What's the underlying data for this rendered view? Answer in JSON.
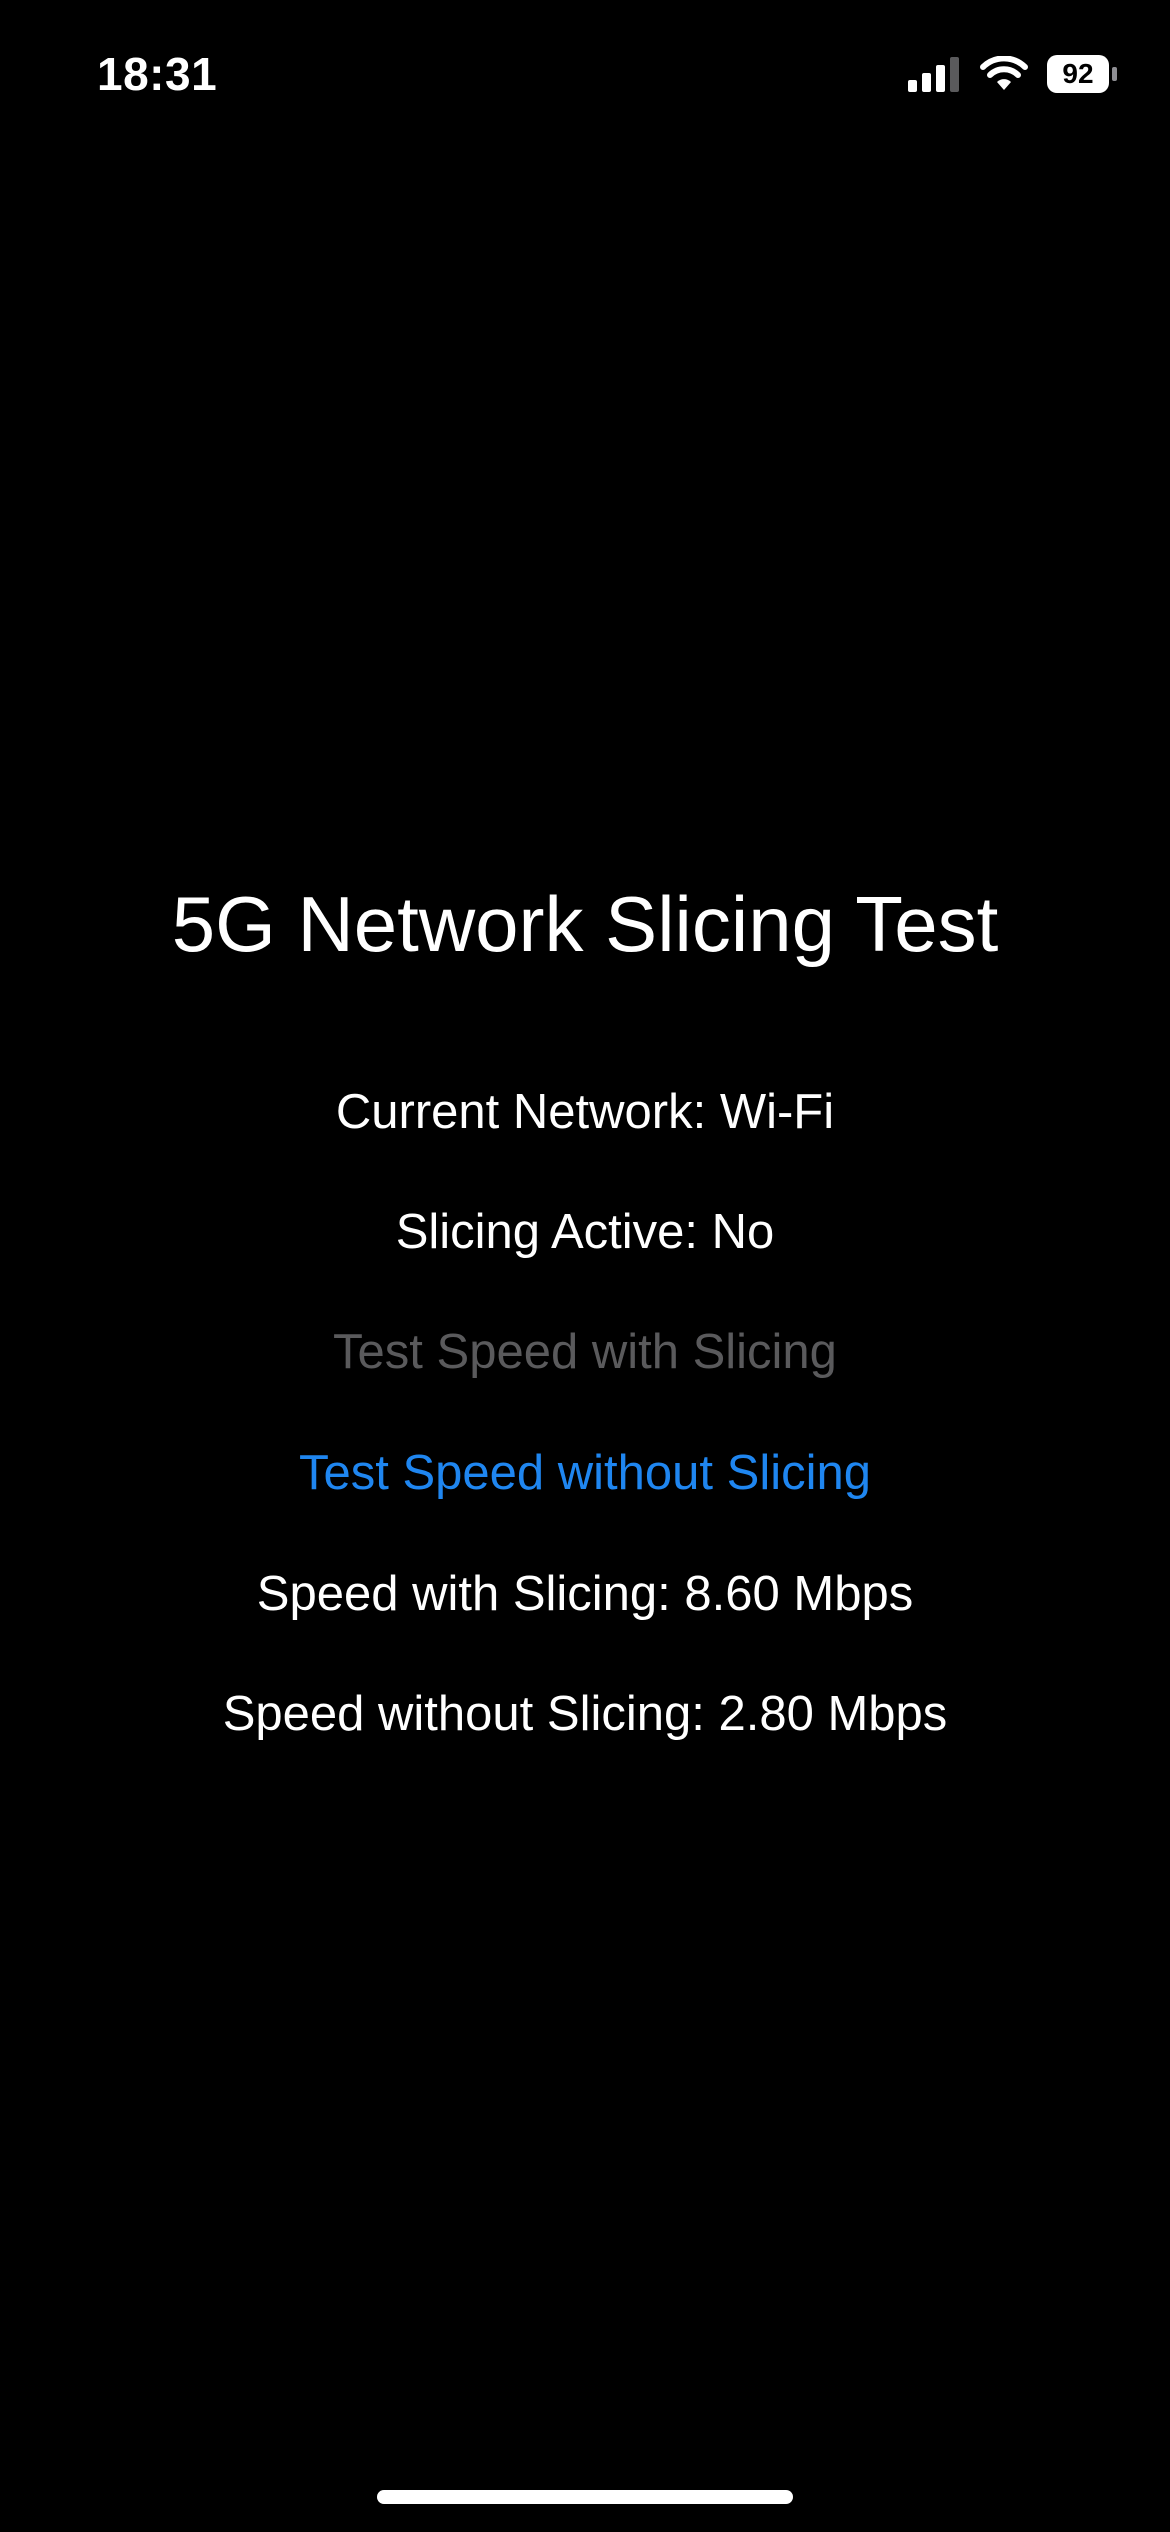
{
  "status_bar": {
    "time": "18:31",
    "battery_level": "92",
    "icons": [
      "signal-icon",
      "wifi-icon",
      "battery-icon"
    ]
  },
  "main": {
    "title": "5G Network Slicing Test",
    "current_network": "Current Network: Wi-Fi",
    "slicing_active": "Slicing Active: No",
    "buttons": {
      "test_with_slicing": "Test Speed with Slicing",
      "test_without_slicing": "Test Speed without Slicing"
    },
    "speed_with_slicing": "Speed with Slicing: 8.60 Mbps",
    "speed_without_slicing": "Speed without Slicing: 2.80 Mbps"
  },
  "colors": {
    "background": "#000000",
    "text": "#ffffff",
    "accent": "#1f86f0",
    "disabled": "#5a5a5c"
  }
}
